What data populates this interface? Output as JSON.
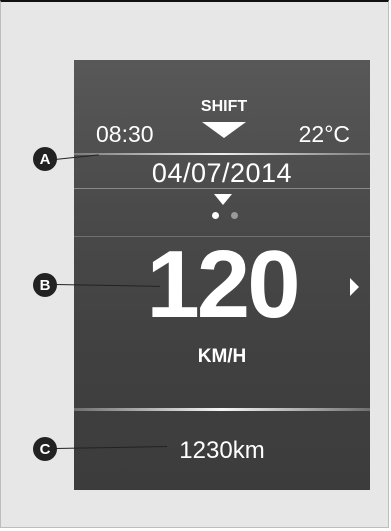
{
  "display": {
    "shift_label": "SHIFT",
    "time": "08:30",
    "temperature": "22°C",
    "date": "04/07/2014",
    "speed": "120",
    "speed_unit": "KM/H",
    "odometer": "1230km",
    "page_indicator": {
      "total": 2,
      "active": 1
    }
  },
  "callouts": {
    "a": "A",
    "b": "B",
    "c": "C"
  },
  "icons": {
    "shift_indicator": "shift-down-arrow-icon",
    "scroll_indicator": "chevron-down-icon",
    "next_indicator": "chevron-right-icon"
  },
  "colors": {
    "screen_background": "#484848",
    "text": "#ffffff",
    "callout": "#222222"
  }
}
